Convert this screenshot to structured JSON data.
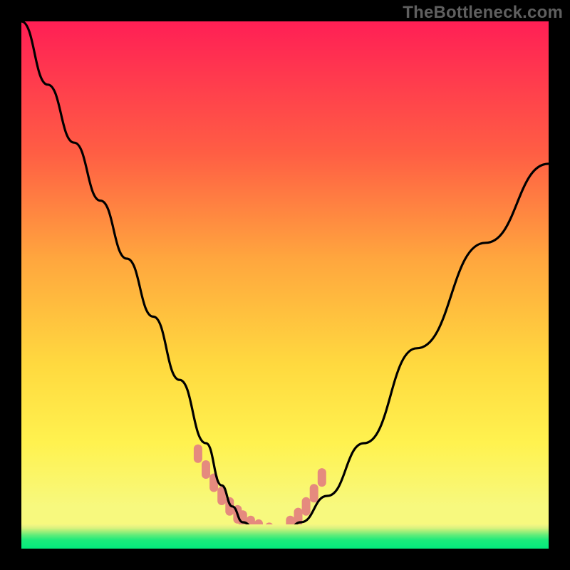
{
  "watermark": "TheBottleneck.com",
  "gradient": {
    "top": "#ff1f55",
    "mid1": "#ff5e44",
    "mid2": "#ffa63e",
    "mid3": "#ffd93f",
    "mid4": "#fff24f",
    "lemon": "#f7f97e",
    "green_top": "#d9f27f",
    "green_mid": "#5dec7a",
    "green_bot": "#03e97c"
  },
  "chart_data": {
    "type": "line",
    "title": "",
    "xlabel": "",
    "ylabel": "",
    "xlim": [
      0,
      100
    ],
    "ylim": [
      0,
      100
    ],
    "legend_position": "none",
    "grid": false,
    "series": [
      {
        "name": "curve",
        "color": "#000000",
        "x": [
          0,
          5,
          10,
          15,
          20,
          25,
          30,
          35,
          38,
          40,
          42,
          45,
          48,
          50,
          53,
          58,
          65,
          75,
          88,
          100
        ],
        "values": [
          100,
          88,
          77,
          66,
          55,
          44,
          32,
          20,
          12,
          8,
          5,
          3,
          3,
          3,
          5,
          10,
          20,
          38,
          58,
          73
        ]
      }
    ],
    "highlight_markers": {
      "name": "threshold-markers",
      "color": "#e58a7e",
      "x": [
        33.5,
        35.0,
        36.5,
        38.0,
        39.5,
        41.0,
        42.0,
        43.5,
        45.0,
        47.0,
        51.0,
        52.5,
        54.0,
        55.5,
        57.0
      ],
      "values": [
        18.0,
        15.0,
        12.5,
        10.0,
        8.0,
        6.5,
        5.5,
        4.5,
        3.8,
        3.2,
        4.5,
        6.0,
        8.0,
        10.5,
        13.5
      ]
    },
    "annotations": []
  }
}
